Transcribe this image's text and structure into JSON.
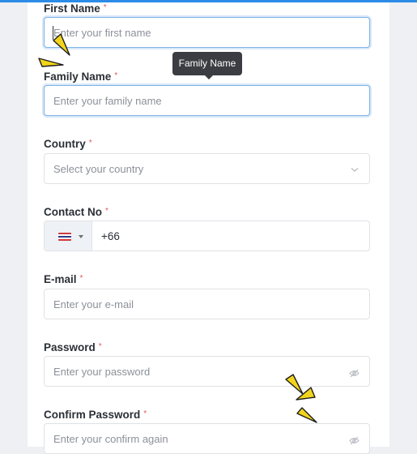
{
  "form": {
    "required_marker": "*",
    "first_name": {
      "label": "First Name",
      "placeholder": "Enter your first name"
    },
    "family_name": {
      "label": "Family Name",
      "placeholder": "Enter your family name",
      "tooltip": "Family Name"
    },
    "country": {
      "label": "Country",
      "placeholder": "Select your country"
    },
    "contact_no": {
      "label": "Contact No",
      "flag": "thailand-flag-icon",
      "code": "+66"
    },
    "email": {
      "label": "E-mail",
      "placeholder": "Enter your e-mail"
    },
    "password": {
      "label": "Password",
      "placeholder": "Enter your password"
    },
    "confirm_password": {
      "label": "Confirm Password",
      "placeholder": "Enter your confirm again"
    }
  },
  "colors": {
    "accent": "#2b8be6",
    "required": "#e45561",
    "tooltip_bg": "#3b3d42",
    "highlight_marks": "#f2d41c"
  }
}
